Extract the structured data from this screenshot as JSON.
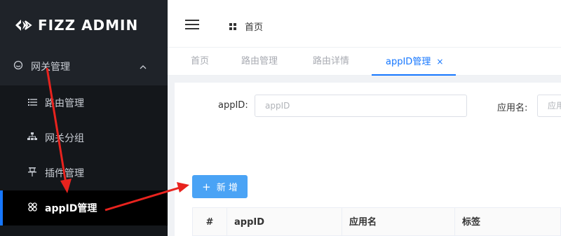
{
  "brand": {
    "name": "FIZZ ADMIN"
  },
  "sidebar": {
    "group": {
      "label": "网关管理",
      "icon": "gateway-icon"
    },
    "items": [
      {
        "label": "路由管理",
        "icon": "list-icon"
      },
      {
        "label": "网关分组",
        "icon": "tree-icon"
      },
      {
        "label": "插件管理",
        "icon": "pin-icon"
      },
      {
        "label": "appID管理",
        "icon": "clover-icon",
        "active": true
      }
    ]
  },
  "header": {
    "breadcrumb": "首页"
  },
  "tabs": [
    {
      "label": "首页"
    },
    {
      "label": "路由管理"
    },
    {
      "label": "路由详情"
    },
    {
      "label": "appID管理",
      "close": "×",
      "active": true
    }
  ],
  "filters": {
    "appid_label": "appID:",
    "appid_placeholder": "appID",
    "app_label": "应用名:",
    "app_placeholder": "应用"
  },
  "actions": {
    "add_label": "新 增",
    "add_icon": "+"
  },
  "table": {
    "columns": [
      "#",
      "appID",
      "应用名",
      "标签"
    ]
  },
  "colors": {
    "accent": "#1677ff",
    "button": "#4aa3f5",
    "sidebar_bg": "#1f2329",
    "annotation": "#e8231e"
  }
}
